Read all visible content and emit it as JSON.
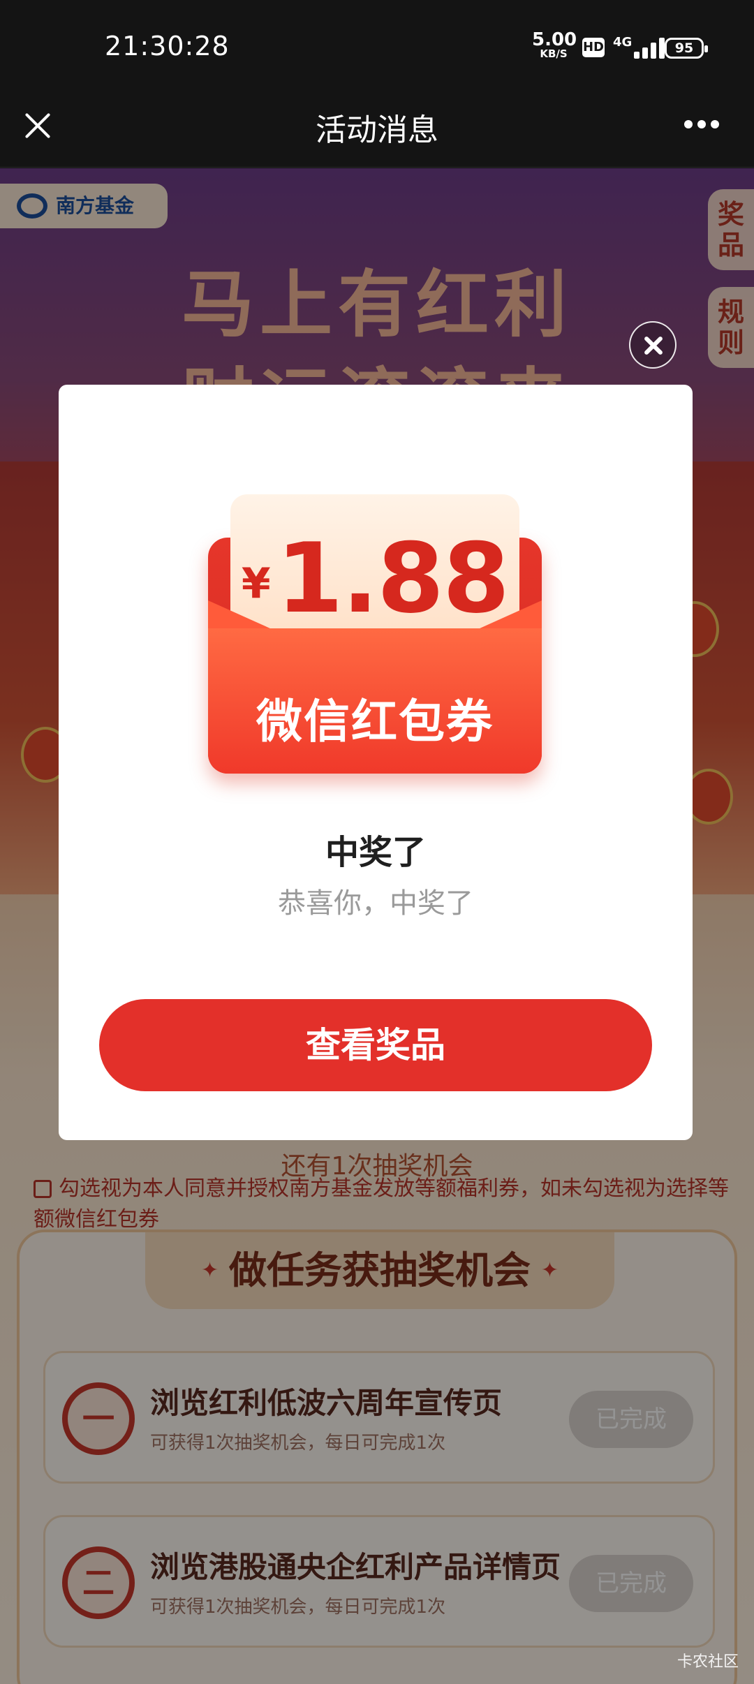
{
  "status_bar": {
    "time": "21:30:28",
    "net_speed_value": "5.00",
    "net_speed_unit": "KB/S",
    "hd_badge": "HD",
    "network_type": "4G",
    "battery": "95"
  },
  "nav": {
    "title": "活动消息",
    "close_icon": "close-icon",
    "more_icon": "more-horizontal-icon"
  },
  "page": {
    "brand": "南方基金",
    "side_tabs": [
      "奖品",
      "规则"
    ],
    "headline_line1": "马上有红利",
    "headline_line2": "财运滚滚来",
    "chances_text": "还有1次抽奖机会",
    "consent_text": "勾选视为本人同意并授权南方基金发放等额福利券，如未勾选视为选择等额微信红包券",
    "task_section_title": "做任务获抽奖机会",
    "tasks": [
      {
        "number": "一",
        "title": "浏览红利低波六周年宣传页",
        "desc": "可获得1次抽奖机会，每日可完成1次",
        "status": "已完成"
      },
      {
        "number": "二",
        "title": "浏览港股通央企红利产品详情页",
        "desc": "可获得1次抽奖机会，每日可完成1次",
        "status": "已完成"
      }
    ]
  },
  "modal": {
    "currency_symbol": "¥",
    "amount": "1.88",
    "coupon_label": "微信红包券",
    "title": "中奖了",
    "subtitle": "恭喜你，中奖了",
    "button_label": "查看奖品",
    "close_icon": "close-icon"
  },
  "watermark": "卡农社区",
  "colors": {
    "accent_red": "#e3302a",
    "status_bar_bg": "#141414"
  }
}
